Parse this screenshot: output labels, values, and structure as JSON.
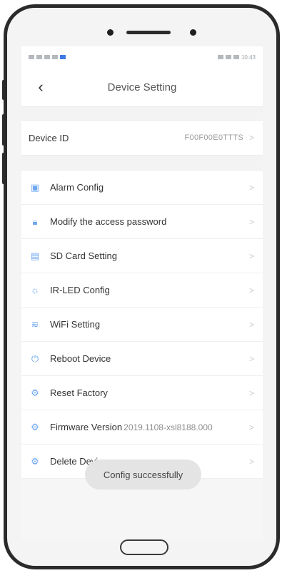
{
  "status_bar": {
    "time": "10:43"
  },
  "nav": {
    "back_symbol": "‹",
    "title": "Device Setting"
  },
  "device_id": {
    "label": "Device ID",
    "value": "F00F00E0TTTS",
    "chevron": ">"
  },
  "items": [
    {
      "label": "Alarm Config",
      "icon": "alarm-icon",
      "glyph": "▣"
    },
    {
      "label": "Modify the access password",
      "icon": "lock-icon",
      "glyph": "🔒︎"
    },
    {
      "label": "SD Card Setting",
      "icon": "sd-card-icon",
      "glyph": "▤"
    },
    {
      "label": "IR-LED Config",
      "icon": "ir-led-icon",
      "glyph": "☼"
    },
    {
      "label": "WiFi Setting",
      "icon": "wifi-icon",
      "glyph": "≋"
    },
    {
      "label": "Reboot Device",
      "icon": "power-icon",
      "glyph": "⏻"
    },
    {
      "label": "Reset Factory",
      "icon": "reset-gear-icon",
      "glyph": "⚙"
    },
    {
      "label": "Firmware Version",
      "value": "2019.1108-xsl8188.000",
      "icon": "firmware-gear-icon",
      "glyph": "⚙"
    },
    {
      "label": "Delete Device",
      "icon": "delete-gear-icon",
      "glyph": "⚙"
    }
  ],
  "chevron": ">",
  "toast": {
    "text": "Config successfully"
  },
  "colors": {
    "accent": "#6ea8f0",
    "background": "#f6f6f6",
    "frame": "#2b2b2b"
  }
}
